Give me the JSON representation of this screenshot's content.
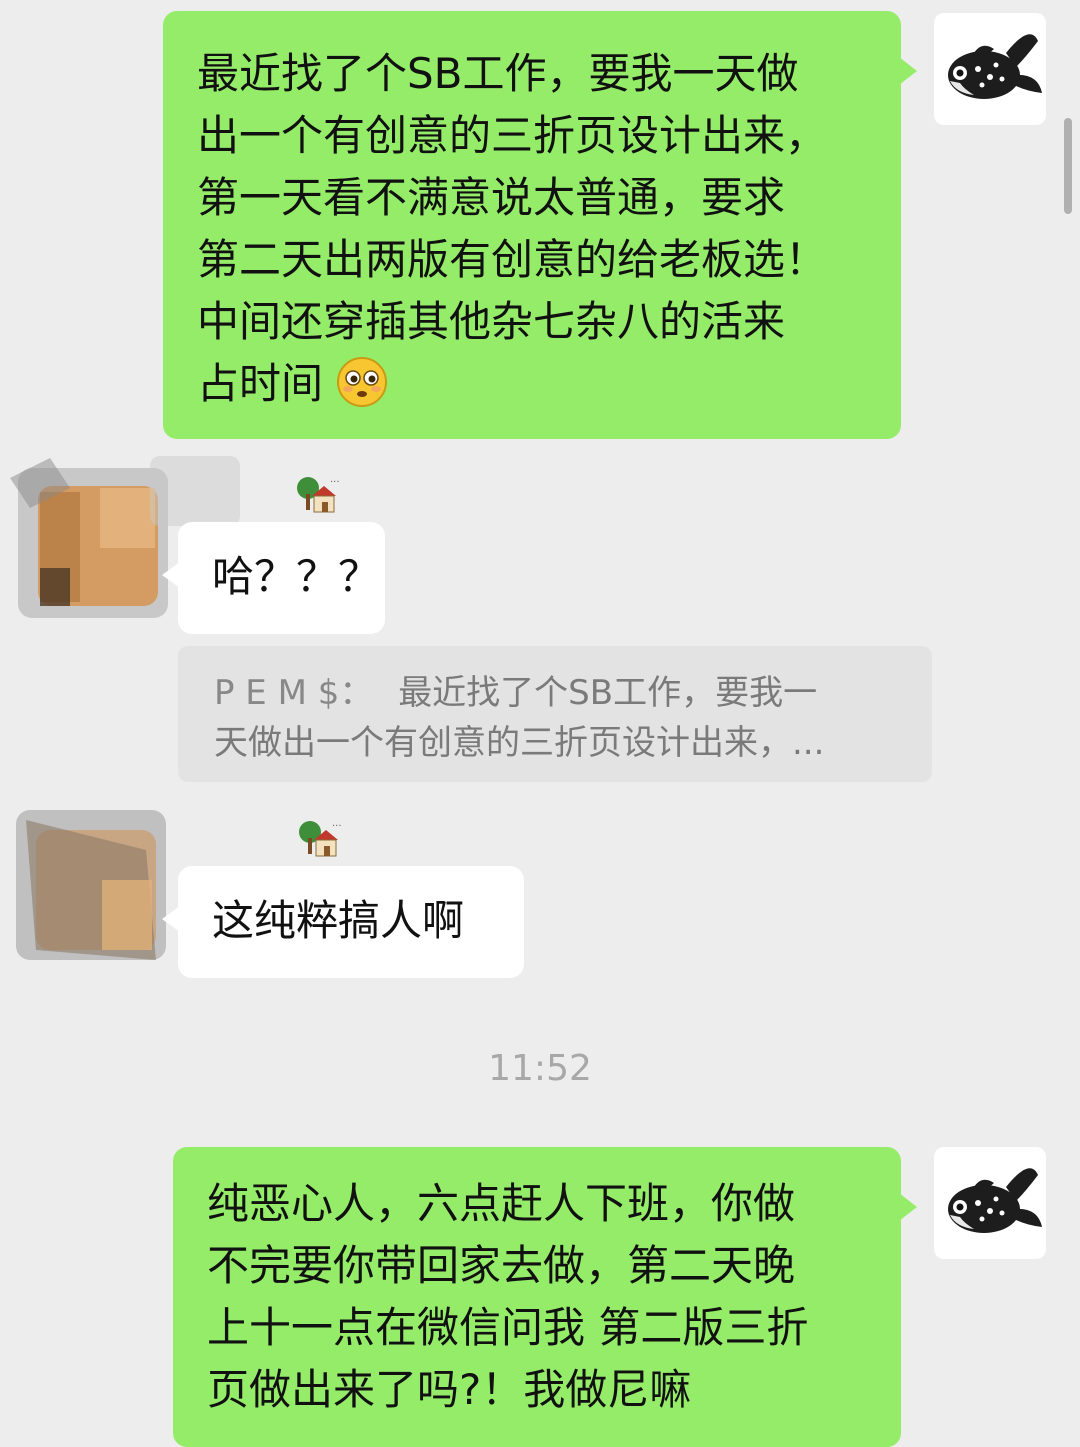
{
  "messages": [
    {
      "side": "right",
      "lines": [
        "最近找了个SB工作，要我一天做",
        "出一个有创意的三折页设计出来，",
        "第一天看不满意说太普通，要求",
        "第二天出两版有创意的给老板选！",
        "中间还穿插其他杂七杂八的活来",
        "占时间"
      ],
      "emoji": "😳"
    },
    {
      "side": "left",
      "text": "哈？？？"
    },
    {
      "side": "left",
      "text": "这纯粹搞人啊"
    },
    {
      "side": "right",
      "lines": [
        "纯恶心人，六点赶人下班，你做",
        "不完要你带回家去做，第二天晚",
        "上十一点在微信问我 第二版三折",
        "页做出来了吗?！我做尼嘛"
      ]
    }
  ],
  "quote": {
    "sender": "P E M $：",
    "line1": "最近找了个SB工作，要我一",
    "line2": "天做出一个有创意的三折页设计出来，..."
  },
  "timestamp": "11:52",
  "colors": {
    "background": "#ededed",
    "self_bubble": "#95ec69",
    "other_bubble": "#ffffff",
    "quote_bg": "#e3e3e3"
  },
  "icons": {
    "self_avatar": "goldfish-avatar",
    "other_avatar": "blurred-avatar",
    "status": "house-tree-icon"
  }
}
